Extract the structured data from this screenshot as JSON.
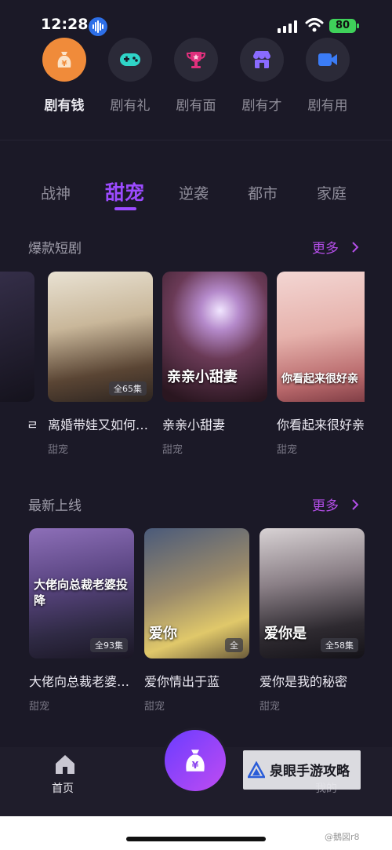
{
  "status_bar": {
    "time": "12:28",
    "battery": "80"
  },
  "top_nav": [
    {
      "label": "剧有钱",
      "icon": "money-bag-icon",
      "active": true
    },
    {
      "label": "剧有礼",
      "icon": "gamepad-icon",
      "active": false
    },
    {
      "label": "剧有面",
      "icon": "trophy-icon",
      "active": false
    },
    {
      "label": "剧有才",
      "icon": "store-icon",
      "active": false
    },
    {
      "label": "剧有用",
      "icon": "video-camera-icon",
      "active": false
    }
  ],
  "genre_tabs": [
    "战神",
    "甜宠",
    "逆袭",
    "都市",
    "家庭"
  ],
  "active_genre": "甜宠",
  "sections": [
    {
      "title": "爆款短剧",
      "more": "更多",
      "items": [
        {
          "title": "离婚带娃又如何…",
          "tag": "甜宠",
          "episodes": "全65集",
          "poster_text": ""
        },
        {
          "title": "亲亲小甜妻",
          "tag": "甜宠",
          "episodes": "",
          "poster_text": "亲亲小甜妻"
        },
        {
          "title": "你看起来很好亲",
          "tag": "甜宠",
          "episodes": "",
          "poster_text": "你看起来很好亲"
        }
      ]
    },
    {
      "title": "最新上线",
      "more": "更多",
      "items": [
        {
          "title": "大佬向总裁老婆…",
          "tag": "甜宠",
          "episodes": "全93集",
          "poster_text": "大佬向总裁老婆投降"
        },
        {
          "title": "爱你情出于蓝",
          "tag": "甜宠",
          "episodes": "全",
          "poster_text": "爱你"
        },
        {
          "title": "爱你是我的秘密",
          "tag": "甜宠",
          "episodes": "全58集",
          "poster_text": "爱你是"
        }
      ]
    }
  ],
  "bottom_nav": {
    "home": "首页",
    "mine": "我的"
  },
  "watermark": "泉眼手游攻略",
  "corner_mark": "@鵝図r8",
  "colors": {
    "accent": "#9c4bff",
    "more": "#b44ee8",
    "active_nav": "#f08b3a",
    "background": "#1b1927"
  }
}
